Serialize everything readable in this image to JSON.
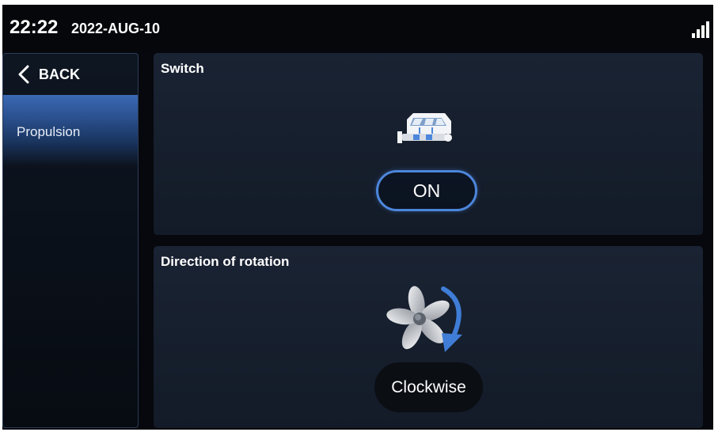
{
  "status_bar": {
    "time": "22:22",
    "date": "2022-AUG-10",
    "signal_icon": "signal-strength-icon"
  },
  "sidebar": {
    "back_label": "BACK",
    "back_icon": "chevron-left-icon",
    "items": [
      {
        "label": "Propulsion",
        "selected": true
      }
    ]
  },
  "main": {
    "switch_card": {
      "title": "Switch",
      "icon": "boat-icon",
      "button_label": "ON"
    },
    "rotation_card": {
      "title": "Direction of rotation",
      "icon": "propeller-clockwise-icon",
      "button_label": "Clockwise"
    }
  },
  "colors": {
    "accent": "#4c86dc",
    "selected_item": "#3b69b4",
    "card_bg": "#1a2333",
    "background": "#06080d"
  }
}
